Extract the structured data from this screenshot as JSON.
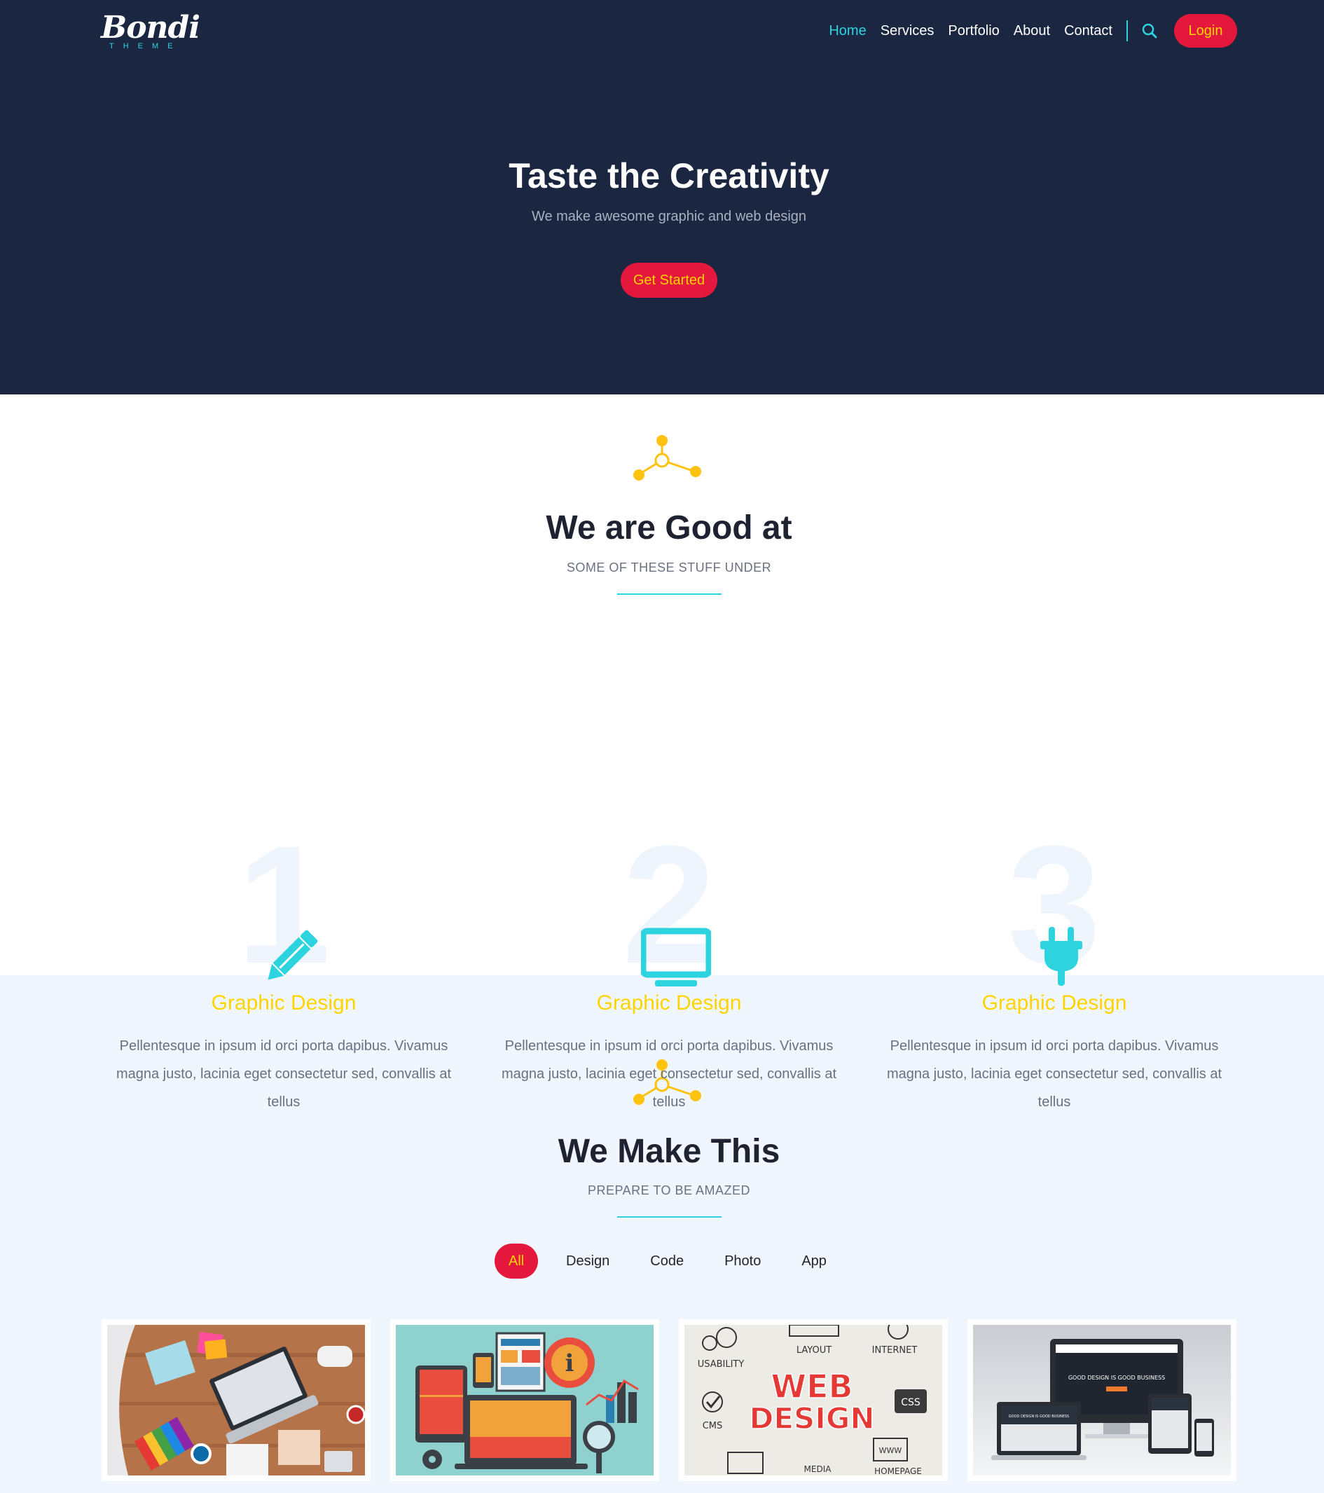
{
  "brand": {
    "name": "Bondi",
    "tagline": "THEME"
  },
  "nav": {
    "items": [
      {
        "label": "Home",
        "active": true
      },
      {
        "label": "Services",
        "active": false
      },
      {
        "label": "Portfolio",
        "active": false
      },
      {
        "label": "About",
        "active": false
      },
      {
        "label": "Contact",
        "active": false
      }
    ],
    "search_icon": "search-icon",
    "login_label": "Login"
  },
  "hero": {
    "title": "Taste the Creativity",
    "subtitle": "We make awesome graphic and web design",
    "cta_label": "Get Started"
  },
  "services": {
    "title": "We are Good at",
    "subtitle": "SOME OF THESE STUFF UNDER",
    "items": [
      {
        "number": "1",
        "icon": "pencil-icon",
        "title": "Graphic Design",
        "desc": "Pellentesque in ipsum id orci porta dapibus. Vivamus magna justo, lacinia eget consectetur sed, convallis at tellus"
      },
      {
        "number": "2",
        "icon": "monitor-icon",
        "title": "Graphic Design",
        "desc": "Pellentesque in ipsum id orci porta dapibus. Vivamus magna justo, lacinia eget consectetur sed, convallis at tellus"
      },
      {
        "number": "3",
        "icon": "plug-icon",
        "title": "Graphic Design",
        "desc": "Pellentesque in ipsum id orci porta dapibus. Vivamus magna justo, lacinia eget consectetur sed, convallis at tellus"
      }
    ]
  },
  "portfolio": {
    "title": "We Make This",
    "subtitle": "PREPARE TO BE AMAZED",
    "filters": [
      {
        "label": "All",
        "active": true
      },
      {
        "label": "Design",
        "active": false
      },
      {
        "label": "Code",
        "active": false
      },
      {
        "label": "Photo",
        "active": false
      },
      {
        "label": "App",
        "active": false
      }
    ],
    "thumb3_words": {
      "usability": "USABILITY",
      "layout": "LAYOUT",
      "internet": "INTERNET",
      "web": "WEB",
      "design": "DESIGN",
      "css": "CSS",
      "cms": "CMS",
      "media": "MEDIA",
      "www": "WWW",
      "homepage": "HOMEPAGE"
    },
    "thumb4_words": {
      "headline": "GOOD DESIGN IS GOOD BUSINESS",
      "small": "GOOD DESIGN IS GOOD BUSINESS"
    }
  },
  "colors": {
    "navy": "#1b2641",
    "accent_cyan": "#2ed3e0",
    "accent_red": "#e4173c",
    "accent_yellow": "#ffd400",
    "light_bg": "#eff6fd"
  }
}
